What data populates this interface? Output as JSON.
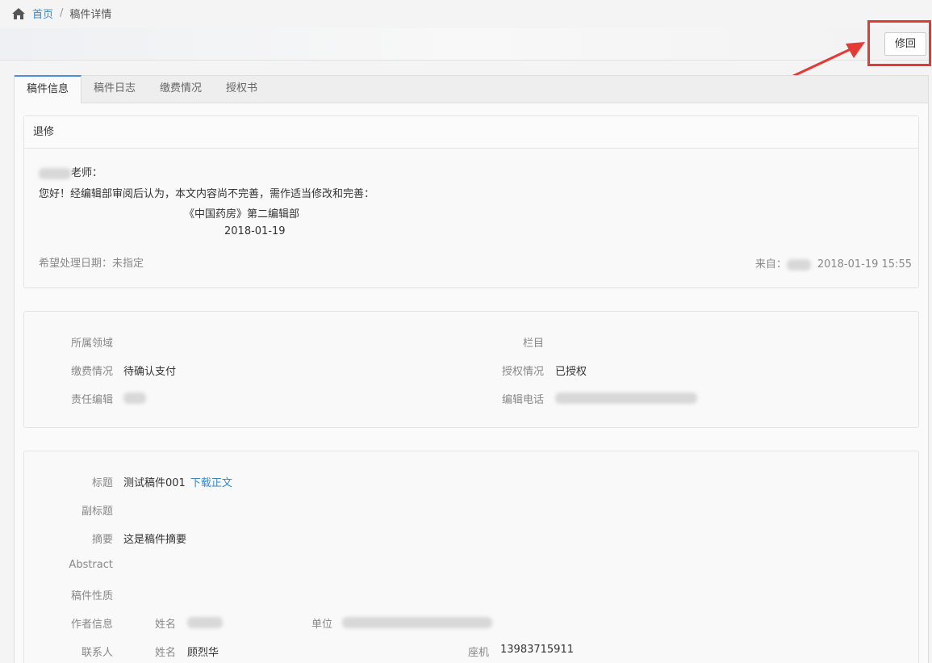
{
  "breadcrumb": {
    "home": "首页",
    "separator": "/",
    "current": "稿件详情"
  },
  "toolbar": {
    "revise_label": "修回"
  },
  "tabs": [
    {
      "label": "稿件信息"
    },
    {
      "label": "稿件日志"
    },
    {
      "label": "缴费情况"
    },
    {
      "label": "授权书"
    }
  ],
  "notice": {
    "title": "退修",
    "salutation": "老师：",
    "body": "您好！经编辑部审阅后认为，本文内容尚不完善，需作适当修改和完善：",
    "signature": "《中国药房》第二编辑部",
    "date": "2018-01-19",
    "deadline": "希望处理日期：未指定",
    "from_label": "来自：",
    "from_time": "2018-01-19 15:55"
  },
  "info": {
    "field_label": "所属领域",
    "column_label": "栏目",
    "fee_label": "缴费情况",
    "fee_value": "待确认支付",
    "auth_label": "授权情况",
    "auth_value": "已授权",
    "editor_label": "责任编辑",
    "phone_label": "编辑电话"
  },
  "manuscript": {
    "title_label": "标题",
    "title_value": "测试稿件001",
    "download_label": "下载正文",
    "subtitle_label": "副标题",
    "abstract_label": "摘要",
    "abstract_value": "这是稿件摘要",
    "abstract_en_label": "Abstract",
    "nature_label": "稿件性质",
    "author_label": "作者信息",
    "author_name_label": "姓名",
    "author_unit_label": "单位",
    "contact_label": "联系人",
    "contact_name_label": "姓名",
    "contact_name_value": "顾烈华",
    "contact_phone_label": "座机",
    "contact_phone_value": "13983715911"
  }
}
